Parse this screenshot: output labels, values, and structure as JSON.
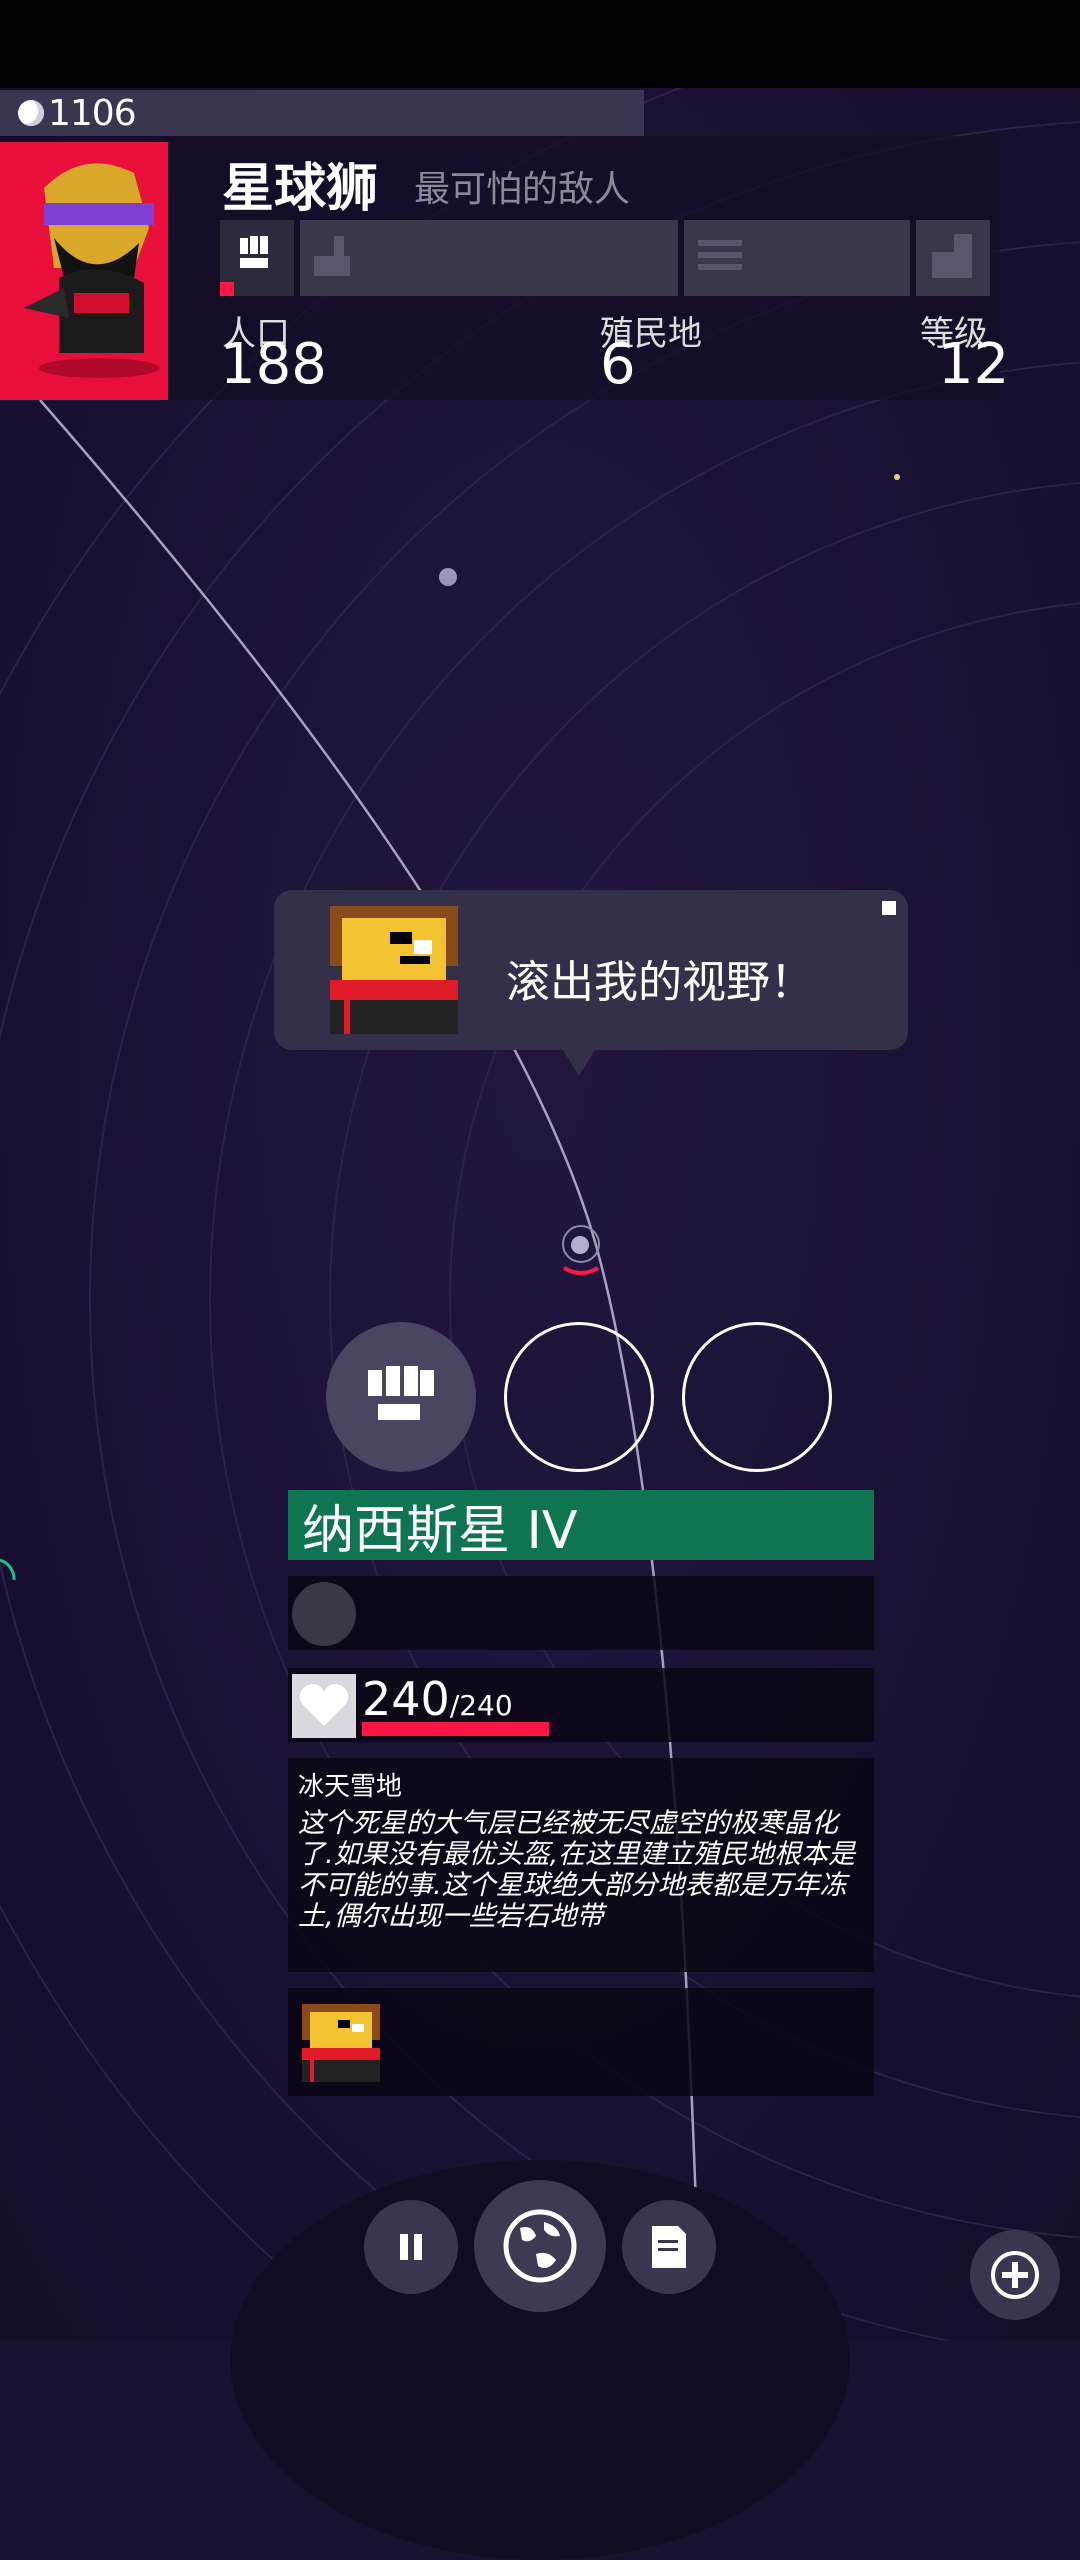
{
  "status_bar": {},
  "currency": {
    "value": "1106",
    "icon": "coin-icon"
  },
  "enemy": {
    "name": "星球狮",
    "title": "最可怕的敌人",
    "stats": {
      "population_label": "人口",
      "population_value": "188",
      "colonies_label": "殖民地",
      "colonies_value": "6",
      "level_label": "等级",
      "level_value": "12"
    },
    "slots": [
      "fist-icon",
      "factory-icon",
      "engine-icon",
      "building-icon"
    ]
  },
  "speech": {
    "text": "滚出我的视野！"
  },
  "actions": [
    "fist-icon",
    "empty",
    "empty"
  ],
  "planet": {
    "name": "纳西斯星 IV",
    "hp_current": "240",
    "hp_max": "/240",
    "hp_fraction": 0.48,
    "terrain_title": "冰天雪地",
    "description": "这个死星的大气层已经被无尽虚空的极寒晶化了.如果没有最优头盔,在这里建立殖民地根本是不可能的事.这个星球绝大部分地表都是万年冻土,偶尔出现一些岩石地带"
  },
  "controls": [
    "pause-icon",
    "globe-icon",
    "notes-icon",
    "zoom-in-icon"
  ],
  "colors": {
    "accent_red": "#ff1744",
    "planet_green": "#0f7450",
    "space": "#1a1130"
  }
}
